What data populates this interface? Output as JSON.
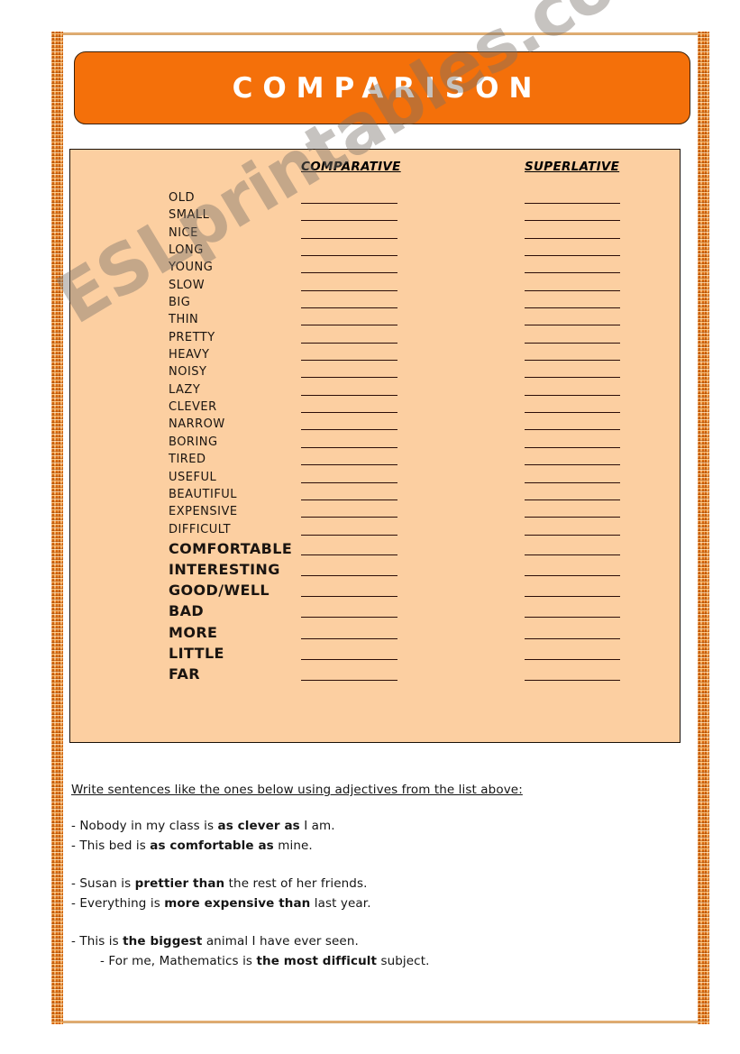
{
  "title": {
    "text": "COMPARISON"
  },
  "watermark": {
    "text": "ESLprintables.com"
  },
  "table": {
    "headers": {
      "comparative": "COMPARATIVE",
      "superlative": "SUPERLATIVE"
    },
    "rows": [
      {
        "word": "OLD",
        "emphasis": false
      },
      {
        "word": "SMALL",
        "emphasis": false
      },
      {
        "word": "NICE",
        "emphasis": false
      },
      {
        "word": "LONG",
        "emphasis": false
      },
      {
        "word": "YOUNG",
        "emphasis": false
      },
      {
        "word": "SLOW",
        "emphasis": false
      },
      {
        "word": "BIG",
        "emphasis": false
      },
      {
        "word": "THIN",
        "emphasis": false
      },
      {
        "word": "PRETTY",
        "emphasis": false
      },
      {
        "word": "HEAVY",
        "emphasis": false
      },
      {
        "word": "NOISY",
        "emphasis": false
      },
      {
        "word": "LAZY",
        "emphasis": false
      },
      {
        "word": "CLEVER",
        "emphasis": false
      },
      {
        "word": "NARROW",
        "emphasis": false
      },
      {
        "word": "BORING",
        "emphasis": false
      },
      {
        "word": "TIRED",
        "emphasis": false
      },
      {
        "word": "USEFUL",
        "emphasis": false
      },
      {
        "word": "BEAUTIFUL",
        "emphasis": false
      },
      {
        "word": "EXPENSIVE",
        "emphasis": false
      },
      {
        "word": "DIFFICULT",
        "emphasis": false
      },
      {
        "word": "COMFORTABLE",
        "emphasis": true
      },
      {
        "word": "INTERESTING",
        "emphasis": true
      },
      {
        "word": "GOOD/WELL",
        "emphasis": true
      },
      {
        "word": "BAD",
        "emphasis": true
      },
      {
        "word": "MORE",
        "emphasis": true
      },
      {
        "word": "LITTLE",
        "emphasis": true
      },
      {
        "word": "FAR",
        "emphasis": true
      }
    ]
  },
  "instructions": {
    "text": "Write sentences  like the ones below using adjectives from the list above:"
  },
  "examples": [
    {
      "prefix": "- Nobody in my class is ",
      "bold": "as clever as",
      "suffix": " I am.",
      "gap_before": false,
      "indented": false
    },
    {
      "prefix": "- This bed is ",
      "bold": "as comfortable as",
      "suffix": " mine.",
      "gap_before": false,
      "indented": false
    },
    {
      "prefix": "- Susan is ",
      "bold": "prettier than",
      "suffix": " the rest of her friends.",
      "gap_before": true,
      "indented": false
    },
    {
      "prefix": "- Everything is ",
      "bold": "more expensive than",
      "suffix": " last year.",
      "gap_before": false,
      "indented": false
    },
    {
      "prefix": "- This is ",
      "bold": "the biggest",
      "suffix": " animal I have ever seen.",
      "gap_before": true,
      "indented": false
    },
    {
      "prefix": "-   For me, Mathematics is ",
      "bold": "the most difficult",
      "suffix": " subject.",
      "gap_before": false,
      "indented": true
    }
  ],
  "colors": {
    "banner_orange": "#f4700a",
    "panel_peach": "#fccfa1",
    "frame_orange": "#e8700d",
    "line_dark": "#2b0d08",
    "watermark_gray": "#787068"
  }
}
